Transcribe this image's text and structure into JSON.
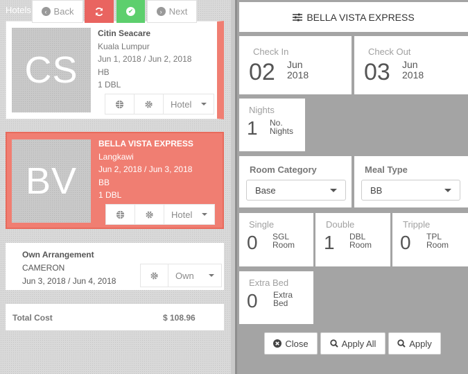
{
  "left": {
    "header": "Hotels",
    "hotels": [
      {
        "initials": "CS",
        "name": "Citin Seacare",
        "city": "Kuala Lumpur",
        "dates": "Jun 1, 2018 / Jun 2, 2018",
        "meal": "HB",
        "room": "1 DBL",
        "type_label": "Hotel"
      },
      {
        "initials": "BV",
        "name": "BELLA VISTA EXPRESS",
        "city": "Langkawi",
        "dates": "Jun 2, 2018 / Jun 3, 2018",
        "meal": "BB",
        "room": "1 DBL",
        "type_label": "Hotel"
      }
    ],
    "own": {
      "name": "Own Arrangement",
      "city": "CAMERON",
      "dates": "Jun 3, 2018 / Jun 4, 2018",
      "type_label": "Own"
    },
    "total": {
      "label": "Total Cost",
      "value": "$ 108.96"
    },
    "nav": {
      "back": "Back",
      "next": "Next"
    }
  },
  "right": {
    "title": "BELLA VISTA EXPRESS",
    "check_in": {
      "label": "Check In",
      "day": "02",
      "month": "Jun",
      "year": "2018"
    },
    "check_out": {
      "label": "Check Out",
      "day": "03",
      "month": "Jun",
      "year": "2018"
    },
    "nights": {
      "label": "Nights",
      "value": "1",
      "unit_line1": "No.",
      "unit_line2": "Nights"
    },
    "room_category": {
      "label": "Room Category",
      "value": "Base"
    },
    "meal_type": {
      "label": "Meal Type",
      "value": "BB"
    },
    "single": {
      "label": "Single",
      "value": "0",
      "unit_line1": "SGL",
      "unit_line2": "Room"
    },
    "double": {
      "label": "Double",
      "value": "1",
      "unit_line1": "DBL",
      "unit_line2": "Room"
    },
    "tripple": {
      "label": "Tripple",
      "value": "0",
      "unit_line1": "TPL",
      "unit_line2": "Room"
    },
    "extra_bed": {
      "label": "Extra Bed",
      "value": "0",
      "unit_line1": "Extra",
      "unit_line2": "Bed"
    },
    "buttons": {
      "close": "Close",
      "apply_all": "Apply All",
      "apply": "Apply"
    }
  },
  "colors": {
    "accent_red": "#f07e72",
    "ok_green": "#5dcf6d",
    "reset_red": "#e96460"
  }
}
